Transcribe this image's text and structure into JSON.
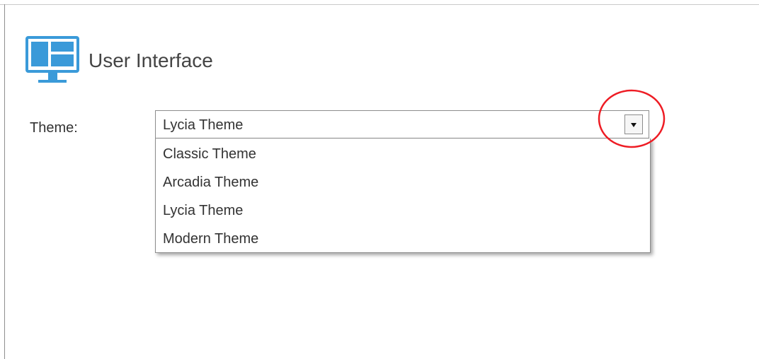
{
  "section": {
    "title": "User Interface",
    "icon": "monitor-layout-icon",
    "icon_color": "#3a9ad9"
  },
  "theme_field": {
    "label": "Theme:",
    "selected_value": "Lycia Theme",
    "dropdown_icon": "chevron-down-icon",
    "options": [
      "Classic Theme",
      "Arcadia Theme",
      "Lycia Theme",
      "Modern Theme"
    ]
  },
  "annotation": {
    "shape": "circle-highlight",
    "color": "#ee1c24"
  }
}
